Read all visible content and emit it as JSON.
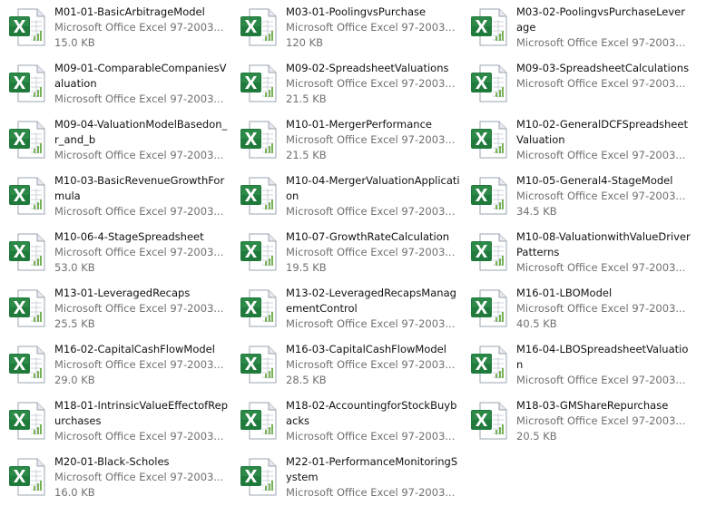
{
  "type_label": "Microsoft Office Excel 97-2003...",
  "icon": "excel-spreadsheet-icon",
  "files": [
    {
      "name": "M01-01-BasicArbitrageModel",
      "size": "15.0 KB"
    },
    {
      "name": "M03-01-PoolingvsPurchase",
      "size": "120 KB"
    },
    {
      "name": "M03-02-PoolingvsPurchaseLeverage",
      "size": null
    },
    {
      "name": "M09-01-ComparableCompaniesValuation",
      "size": null
    },
    {
      "name": "M09-02-SpreadsheetValuations",
      "size": "21.5 KB"
    },
    {
      "name": "M09-03-SpreadsheetCalculations",
      "size": null
    },
    {
      "name": "M09-04-ValuationModelBasedon_r_and_b",
      "size": null
    },
    {
      "name": "M10-01-MergerPerformance",
      "size": "21.5 KB"
    },
    {
      "name": "M10-02-GeneralDCFSpreadsheetValuation",
      "size": null
    },
    {
      "name": "M10-03-BasicRevenueGrowthFormula",
      "size": null
    },
    {
      "name": "M10-04-MergerValuationApplication",
      "size": null
    },
    {
      "name": "M10-05-General4-StageModel",
      "size": "34.5 KB"
    },
    {
      "name": "M10-06-4-StageSpreadsheet",
      "size": "53.0 KB"
    },
    {
      "name": "M10-07-GrowthRateCalculation",
      "size": "19.5 KB"
    },
    {
      "name": "M10-08-ValuationwithValueDriverPatterns",
      "size": null
    },
    {
      "name": "M13-01-LeveragedRecaps",
      "size": "25.5 KB"
    },
    {
      "name": "M13-02-LeveragedRecapsManagementControl",
      "size": null
    },
    {
      "name": "M16-01-LBOModel",
      "size": "40.5 KB"
    },
    {
      "name": "M16-02-CapitalCashFlowModel",
      "size": "29.0 KB"
    },
    {
      "name": "M16-03-CapitalCashFlowModel",
      "size": "28.5 KB"
    },
    {
      "name": "M16-04-LBOSpreadsheetValuation",
      "size": null
    },
    {
      "name": "M18-01-IntrinsicValueEffectofRepurchases",
      "size": null
    },
    {
      "name": "M18-02-AccountingforStockBuybacks",
      "size": null
    },
    {
      "name": "M18-03-GMShareRepurchase",
      "size": "20.5 KB"
    },
    {
      "name": "M20-01-Black-Scholes",
      "size": "16.0 KB"
    },
    {
      "name": "M22-01-PerformanceMonitoringSystem",
      "size": null
    }
  ]
}
